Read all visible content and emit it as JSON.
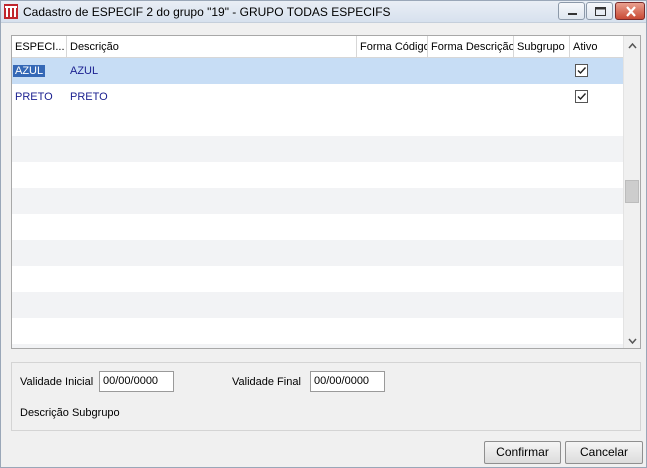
{
  "window": {
    "title": "Cadastro de ESPECIF 2 do grupo \"19\" - GRUPO TODAS ESPECIFS",
    "icon": "app-logo-icon",
    "controls": [
      "minimize-icon",
      "maximize-icon",
      "close-icon"
    ]
  },
  "grid": {
    "columns": [
      "ESPECI...",
      "Descrição",
      "Forma Código",
      "Forma Descrição",
      "Subgrupo",
      "Ativo"
    ],
    "rows": [
      {
        "especif": "AZUL",
        "descricao": "AZUL",
        "forma_codigo": "",
        "forma_descricao": "",
        "subgrupo": "",
        "ativo": true,
        "selected": true
      },
      {
        "especif": "PRETO",
        "descricao": "PRETO",
        "forma_codigo": "",
        "forma_descricao": "",
        "subgrupo": "",
        "ativo": true,
        "selected": false
      }
    ]
  },
  "form": {
    "validade_inicial_label": "Validade Inicial",
    "validade_inicial_value": "00/00/0000",
    "validade_final_label": "Validade Final",
    "validade_final_value": "00/00/0000",
    "descricao_subgrupo_label": "Descrição Subgrupo"
  },
  "buttons": {
    "confirm": "Confirmar",
    "cancel": "Cancelar"
  },
  "colors": {
    "selected_row": "#c7ddf5",
    "selected_cell": "#3568b6",
    "row_text": "#1a1f8f",
    "close_button": "#c94a35"
  }
}
